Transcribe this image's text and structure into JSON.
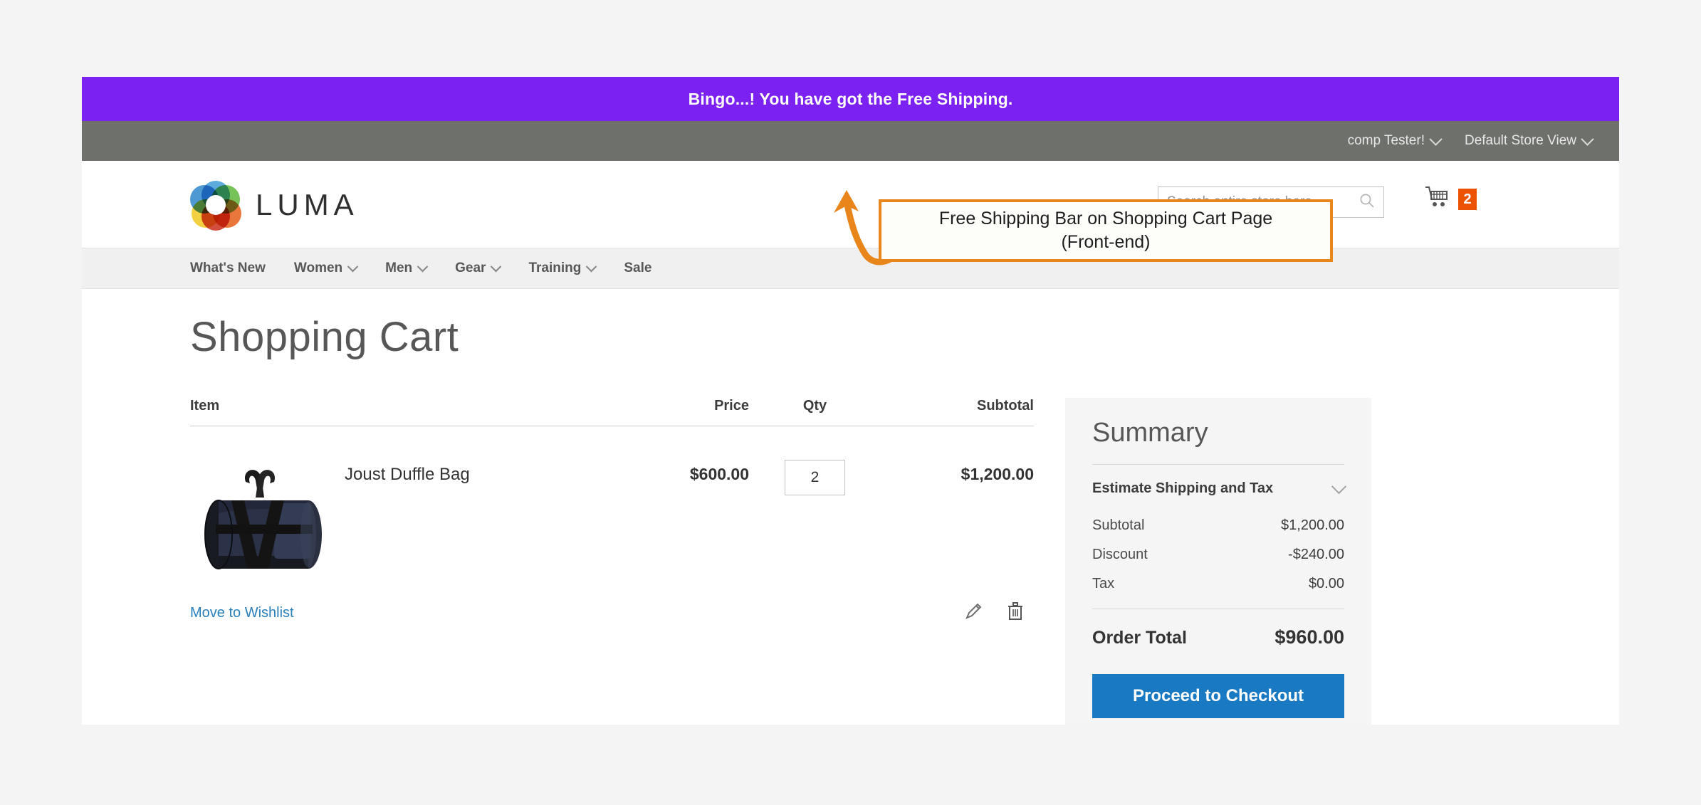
{
  "promo_bar": {
    "text": "Bingo...! You have got the Free Shipping.",
    "background": "#7b22f2",
    "text_color": "#ffffff"
  },
  "admin_bar": {
    "background": "#6e706b",
    "links": [
      {
        "label": "comp Tester!",
        "icon": "chevron-down-icon"
      },
      {
        "label": "Default Store View",
        "icon": "chevron-down-icon"
      }
    ]
  },
  "header": {
    "logo_text": "LUMA",
    "logo_icon": "luma-rings-logo",
    "search": {
      "placeholder": "Search entire store here...",
      "value": "",
      "icon": "search-icon"
    },
    "cart": {
      "icon": "shopping-cart-icon",
      "count": "2",
      "badge_color": "#eb5202"
    }
  },
  "nav": {
    "items": [
      {
        "label": "What's New",
        "has_caret": false
      },
      {
        "label": "Women",
        "has_caret": true
      },
      {
        "label": "Men",
        "has_caret": true
      },
      {
        "label": "Gear",
        "has_caret": true
      },
      {
        "label": "Training",
        "has_caret": true
      },
      {
        "label": "Sale",
        "has_caret": false
      }
    ]
  },
  "page": {
    "title": "Shopping Cart"
  },
  "cart_table": {
    "columns": {
      "item": "Item",
      "price": "Price",
      "qty": "Qty",
      "subtotal": "Subtotal"
    },
    "rows": [
      {
        "product_name": "Joust Duffle Bag",
        "product_image": "joust-duffle-bag-photo",
        "price": "$600.00",
        "qty": "2",
        "subtotal": "$1,200.00"
      }
    ],
    "row_actions": {
      "wishlist_label": "Move to Wishlist",
      "edit_icon": "pencil-icon",
      "delete_icon": "trash-icon",
      "link_color": "#2a7fb9"
    }
  },
  "summary": {
    "title": "Summary",
    "estimate_label": "Estimate Shipping and Tax",
    "estimate_icon": "chevron-down-icon",
    "lines": [
      {
        "label": "Subtotal",
        "value": "$1,200.00"
      },
      {
        "label": "Discount",
        "value": "-$240.00"
      },
      {
        "label": "Tax",
        "value": "$0.00"
      }
    ],
    "order_total_label": "Order Total",
    "order_total_value": "$960.00",
    "checkout_label": "Proceed to Checkout",
    "checkout_color": "#1979c3"
  },
  "annotation": {
    "line1": "Free Shipping Bar on Shopping Cart Page",
    "line2": "(Front-end)",
    "accent_color": "#e8861c",
    "arrow_icon": "curved-arrow-up-icon"
  }
}
